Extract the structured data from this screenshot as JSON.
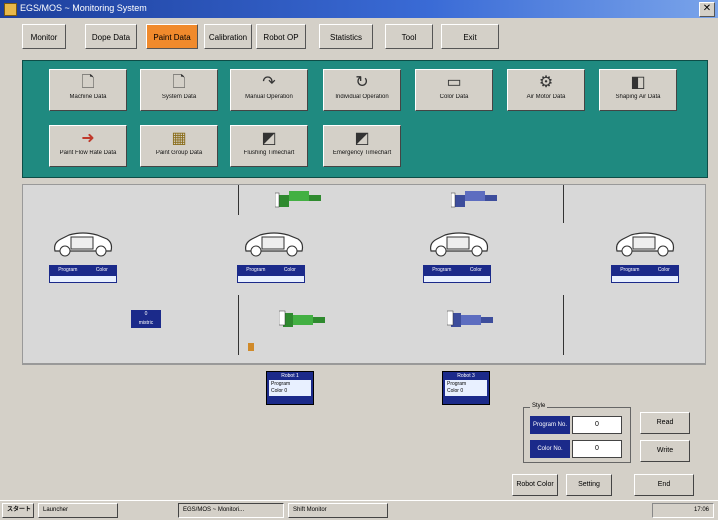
{
  "window": {
    "title": "EGS/MOS ~ Monitoring System",
    "close_glyph": "✕"
  },
  "menu": {
    "tabs": [
      {
        "label": "Monitor",
        "active": false
      },
      {
        "label": "Dope Data",
        "active": false
      },
      {
        "label": "Paint Data",
        "active": true
      },
      {
        "label": "Calibration",
        "active": false
      },
      {
        "label": "Robot OP",
        "active": false
      },
      {
        "label": "Statistics",
        "active": false
      },
      {
        "label": "Tool",
        "active": false
      },
      {
        "label": "Exit",
        "active": false
      }
    ]
  },
  "paint_buttons": [
    {
      "label": "Machine Data",
      "icon": "document-icon",
      "glyph": "🗋"
    },
    {
      "label": "System Data",
      "icon": "document-icon",
      "glyph": "🗋"
    },
    {
      "label": "Manual Operation",
      "icon": "spray-gun-icon",
      "glyph": "↷"
    },
    {
      "label": "Individual Operation",
      "icon": "spray-gun-icon",
      "glyph": "↻"
    },
    {
      "label": "Color Data",
      "icon": "color-bar-icon",
      "glyph": "▭"
    },
    {
      "label": "Air Motor Data",
      "icon": "air-motor-icon",
      "glyph": "⚙"
    },
    {
      "label": "Shaping Air Data",
      "icon": "shaping-air-icon",
      "glyph": "◧"
    },
    {
      "label": "Paint Flow Rate Data",
      "icon": "flow-rate-icon",
      "glyph": "➜"
    },
    {
      "label": "Paint Group Data",
      "icon": "calculator-icon",
      "glyph": "▦"
    },
    {
      "label": "Flushing Timechart",
      "icon": "timechart-icon",
      "glyph": "◩"
    },
    {
      "label": "Emergency Timechart",
      "icon": "timechart-icon",
      "glyph": "◩"
    }
  ],
  "line": {
    "stations": [
      {
        "program_label": "Program",
        "color_label": "Color"
      },
      {
        "program_label": "Program",
        "color_label": "Color"
      },
      {
        "program_label": "Program",
        "color_label": "Color"
      },
      {
        "program_label": "Program",
        "color_label": "Color"
      }
    ],
    "small_box": {
      "line1": "0",
      "line2": "mistric"
    }
  },
  "robots": [
    {
      "title": "Robot 1",
      "program_label": "Program",
      "color_label": "Color",
      "color_value": "0"
    },
    {
      "title": "Robot 3",
      "program_label": "Program",
      "color_label": "Color",
      "color_value": "0"
    }
  ],
  "style_panel": {
    "legend": "Style",
    "rows": [
      {
        "key": "Program No.",
        "value": "0"
      },
      {
        "key": "Color No.",
        "value": "0"
      }
    ],
    "read_label": "Read",
    "write_label": "Write"
  },
  "bottom_buttons": {
    "robot_color": "Robot Color",
    "setting": "Setting",
    "end": "End"
  },
  "taskbar": {
    "start_label": "スタート",
    "items": [
      "Launcher",
      "EGS/MOS ~ Monitori...",
      "Shift Monitor"
    ],
    "clock": "17:06"
  }
}
